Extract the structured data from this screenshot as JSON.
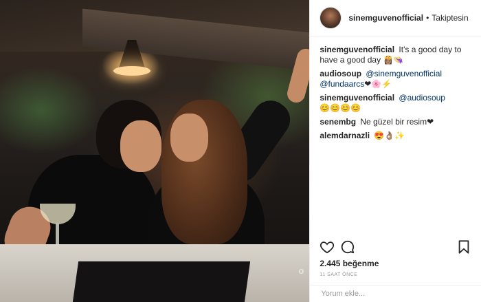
{
  "post": {
    "username": "sinemguvenofficial",
    "separator": "•",
    "follow_status": "Takiptesin",
    "photo_alt": "photo-of-two-women-laughing",
    "watermark": "o"
  },
  "comments": [
    {
      "user": "sinemguvenofficial",
      "text": "It's a good day to have a good day",
      "emoji": "👸🏽👒"
    },
    {
      "user": "audiosoup",
      "mention1": "@sinemguvenofficial",
      "mention2": "@fundaarcs",
      "emoji": "❤🌸⚡"
    },
    {
      "user": "sinemguvenofficial",
      "mention1": "@audiosoup",
      "emoji": "😊😊😊😊"
    },
    {
      "user": "senembg",
      "text": "Ne güzel bir resim",
      "emoji": "❤"
    },
    {
      "user": "alemdarnazli",
      "text": "",
      "emoji": "😍👌🏽✨"
    }
  ],
  "actions": {
    "like_icon": "heart-icon",
    "comment_icon": "speech-bubble-icon",
    "save_icon": "bookmark-icon"
  },
  "likes": "2.445 beğenme",
  "timestamp": "11 SAAT ÖNCE",
  "add_comment": {
    "placeholder": "Yorum ekle..."
  },
  "colors": {
    "text": "#262626",
    "mention": "#003569",
    "muted": "#999999",
    "divider": "#efefef"
  }
}
